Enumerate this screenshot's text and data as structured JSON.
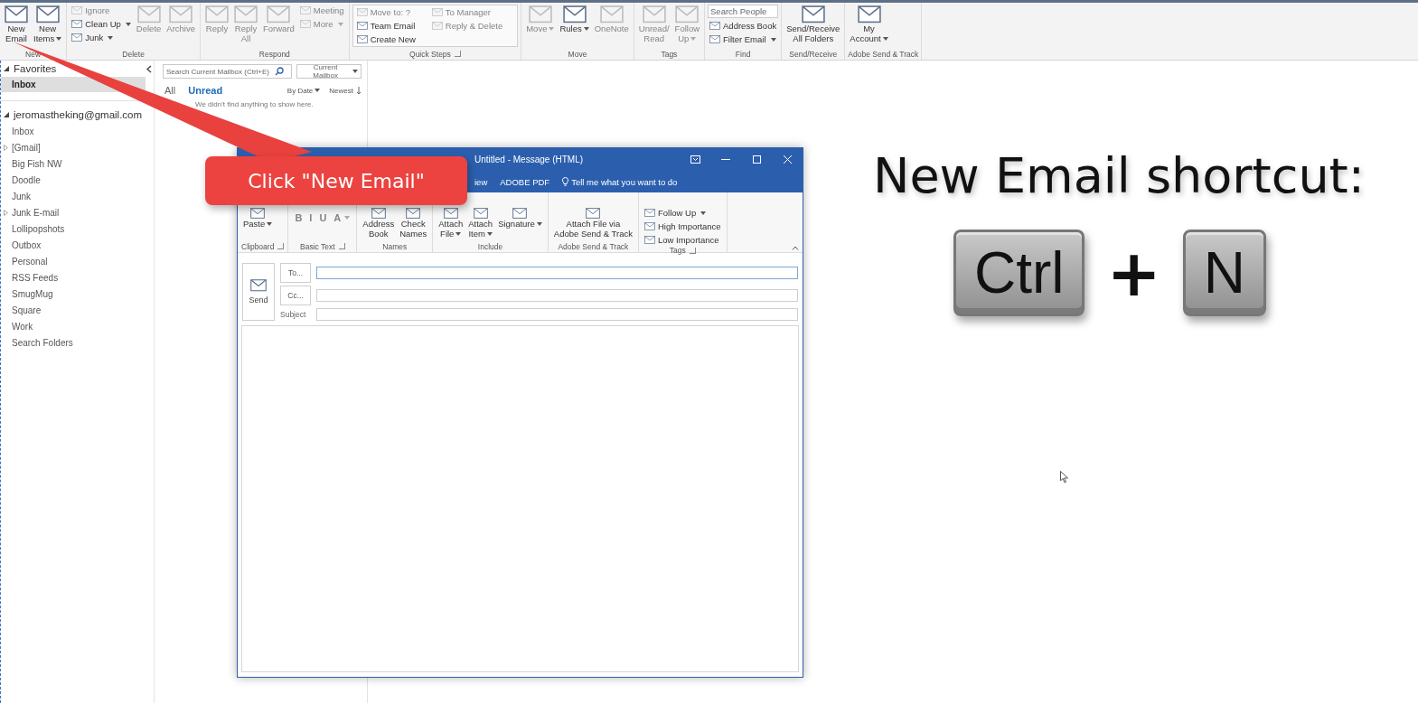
{
  "ribbon": {
    "groups": [
      {
        "label": "New",
        "items": [
          {
            "label": "New\nEmail",
            "kind": "large",
            "disabled": false,
            "dropdown": false
          },
          {
            "label": "New\nItems",
            "kind": "large",
            "disabled": false,
            "dropdown": true
          }
        ]
      },
      {
        "label": "Delete",
        "items": [
          {
            "label": "Ignore",
            "kind": "small",
            "disabled": true,
            "dropdown": false
          },
          {
            "label": "Clean Up",
            "kind": "small",
            "disabled": false,
            "dropdown": true
          },
          {
            "label": "Junk",
            "kind": "small",
            "disabled": false,
            "dropdown": true
          },
          {
            "label": "Delete",
            "kind": "large",
            "disabled": true,
            "dropdown": false
          },
          {
            "label": "Archive",
            "kind": "large",
            "disabled": true,
            "dropdown": false
          }
        ]
      },
      {
        "label": "Respond",
        "items": [
          {
            "label": "Reply",
            "kind": "large",
            "disabled": true,
            "dropdown": false
          },
          {
            "label": "Reply\nAll",
            "kind": "large",
            "disabled": true,
            "dropdown": false
          },
          {
            "label": "Forward",
            "kind": "large",
            "disabled": true,
            "dropdown": false
          },
          {
            "label": "Meeting",
            "kind": "small",
            "disabled": true,
            "dropdown": false
          },
          {
            "label": "More",
            "kind": "small",
            "disabled": true,
            "dropdown": true
          }
        ]
      },
      {
        "label": "Quick Steps",
        "gallery": true,
        "launcher": true,
        "items": [
          {
            "label": "Move to: ?",
            "kind": "small",
            "disabled": true,
            "dropdown": false
          },
          {
            "label": "Team Email",
            "kind": "small",
            "disabled": false,
            "dropdown": false
          },
          {
            "label": "Create New",
            "kind": "small",
            "disabled": false,
            "dropdown": false
          },
          {
            "label": "To Manager",
            "kind": "small",
            "disabled": true,
            "dropdown": false
          },
          {
            "label": "Reply & Delete",
            "kind": "small",
            "disabled": true,
            "dropdown": false
          }
        ]
      },
      {
        "label": "Move",
        "items": [
          {
            "label": "Move",
            "kind": "large",
            "disabled": true,
            "dropdown": true
          },
          {
            "label": "Rules",
            "kind": "large",
            "disabled": false,
            "dropdown": true
          },
          {
            "label": "OneNote",
            "kind": "large",
            "disabled": true,
            "dropdown": false
          }
        ]
      },
      {
        "label": "Tags",
        "items": [
          {
            "label": "Unread/\nRead",
            "kind": "large",
            "disabled": true,
            "dropdown": false
          },
          {
            "label": "Follow\nUp",
            "kind": "large",
            "disabled": true,
            "dropdown": true
          }
        ]
      },
      {
        "label": "Find",
        "items": [
          {
            "placeholder": "Search People",
            "kind": "field"
          },
          {
            "label": "Address Book",
            "kind": "small",
            "disabled": false,
            "dropdown": false
          },
          {
            "label": "Filter Email",
            "kind": "small",
            "disabled": false,
            "dropdown": true
          }
        ]
      },
      {
        "label": "Send/Receive",
        "items": [
          {
            "label": "Send/Receive\nAll Folders",
            "kind": "large",
            "disabled": false,
            "dropdown": false
          }
        ]
      },
      {
        "label": "Adobe Send & Track",
        "items": [
          {
            "label": "My\nAccount",
            "kind": "large",
            "disabled": false,
            "dropdown": true
          }
        ]
      }
    ]
  },
  "sidebar": {
    "favorites": {
      "label": "Favorites",
      "expanded": true,
      "items": [
        {
          "label": "Inbox",
          "selected": true
        }
      ]
    },
    "account": {
      "label": "jeromastheking@gmail.com",
      "expanded": true,
      "items": [
        {
          "label": "Inbox",
          "kind": "leaf",
          "selected": false
        },
        {
          "label": "[Gmail]",
          "kind": "collapsed",
          "selected": false
        },
        {
          "label": "Big Fish NW",
          "kind": "leaf",
          "selected": false
        },
        {
          "label": "Doodle",
          "kind": "leaf",
          "selected": false
        },
        {
          "label": "Junk",
          "kind": "leaf",
          "selected": false
        },
        {
          "label": "Junk E-mail",
          "kind": "collapsed",
          "selected": false
        },
        {
          "label": "Lollipopshots",
          "kind": "leaf",
          "selected": false
        },
        {
          "label": "Outbox",
          "kind": "leaf",
          "selected": false
        },
        {
          "label": "Personal",
          "kind": "leaf",
          "selected": false
        },
        {
          "label": "RSS Feeds",
          "kind": "leaf",
          "selected": false
        },
        {
          "label": "SmugMug",
          "kind": "leaf",
          "selected": false
        },
        {
          "label": "Square",
          "kind": "leaf",
          "selected": false
        },
        {
          "label": "Work",
          "kind": "leaf",
          "selected": false
        },
        {
          "label": "Search Folders",
          "kind": "leaf",
          "selected": false
        }
      ]
    }
  },
  "message_list": {
    "search": {
      "placeholder": "Search Current Mailbox (Ctrl+E)"
    },
    "scope": "Current Mailbox",
    "filters": [
      {
        "label": "All",
        "selected": false
      },
      {
        "label": "Unread",
        "selected": true
      }
    ],
    "sort": "By Date",
    "order": "Newest",
    "empty_text": "We didn't find anything to show here."
  },
  "message_window": {
    "title": "Untitled - Message (HTML)",
    "tabs": [
      {
        "label": "iew",
        "selected": false
      },
      {
        "label": "ADOBE PDF",
        "selected": false
      }
    ],
    "tell_me": "Tell me what you want to do",
    "groups": [
      {
        "label": "Clipboard",
        "launcher": true,
        "items": [
          {
            "label": "Paste",
            "kind": "large",
            "disabled": false,
            "dropdown": true
          }
        ]
      },
      {
        "label": "Basic Text",
        "launcher": true,
        "items": [
          {
            "label": "B",
            "kind": "glyph",
            "disabled": true,
            "dropdown": false
          },
          {
            "label": "I",
            "kind": "glyph",
            "disabled": true,
            "dropdown": false
          },
          {
            "label": "U",
            "kind": "glyph",
            "disabled": true,
            "dropdown": false
          },
          {
            "label": "A",
            "kind": "glyph",
            "disabled": true,
            "dropdown": true
          }
        ]
      },
      {
        "label": "Names",
        "items": [
          {
            "label": "Address\nBook",
            "kind": "large",
            "disabled": false,
            "dropdown": false
          },
          {
            "label": "Check\nNames",
            "kind": "large",
            "disabled": false,
            "dropdown": false
          }
        ]
      },
      {
        "label": "Include",
        "items": [
          {
            "label": "Attach\nFile",
            "kind": "large",
            "disabled": false,
            "dropdown": true
          },
          {
            "label": "Attach\nItem",
            "kind": "large",
            "disabled": false,
            "dropdown": true
          },
          {
            "label": "Signature",
            "kind": "large",
            "disabled": false,
            "dropdown": true
          }
        ]
      },
      {
        "label": "Adobe Send & Track",
        "items": [
          {
            "label": "Attach File via\nAdobe Send & Track",
            "kind": "large",
            "disabled": false,
            "dropdown": false
          }
        ]
      },
      {
        "label": "Tags",
        "launcher": true,
        "items": [
          {
            "label": "Follow Up",
            "kind": "small",
            "disabled": false,
            "dropdown": true
          },
          {
            "label": "High Importance",
            "kind": "small",
            "disabled": false,
            "dropdown": false
          },
          {
            "label": "Low Importance",
            "kind": "small",
            "disabled": false,
            "dropdown": false
          }
        ]
      }
    ],
    "send": "Send",
    "to": "To...",
    "cc": "Cc...",
    "subject": "Subject"
  },
  "callout": "Click \"New Email\"",
  "shortcut": {
    "title": "New Email shortcut:",
    "keys": [
      "Ctrl",
      "N"
    ],
    "joiner": "+"
  }
}
